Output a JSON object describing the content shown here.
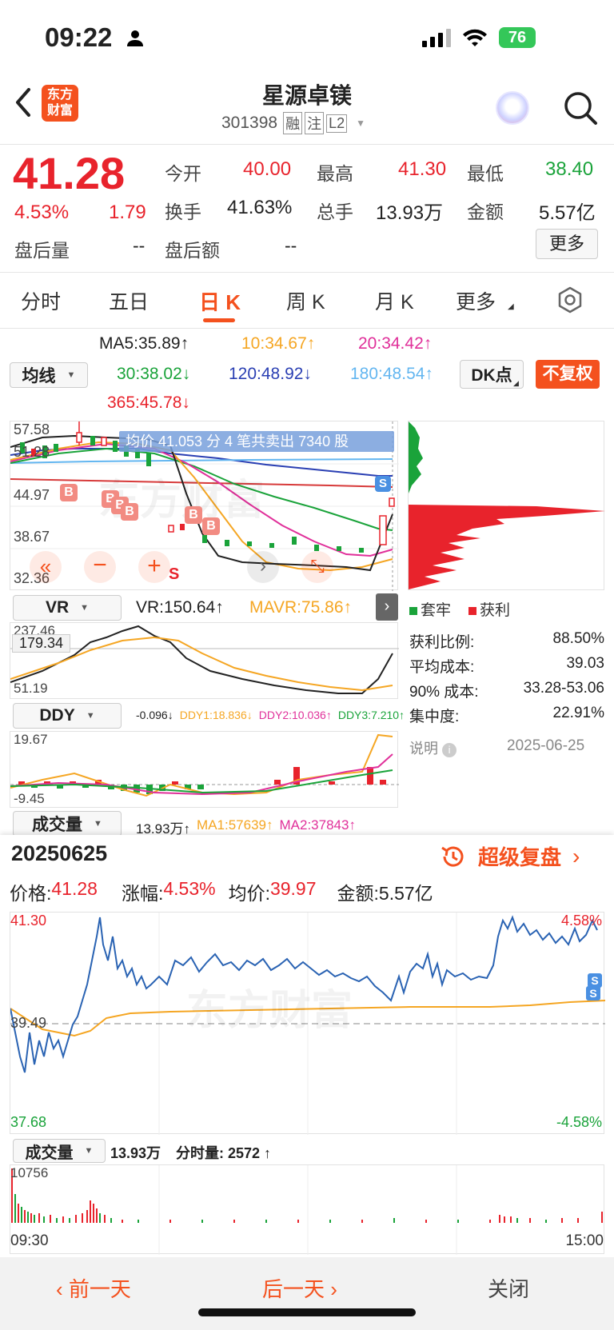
{
  "status": {
    "time": "09:22",
    "battery": "76"
  },
  "header": {
    "title": "星源卓镁",
    "code": "301398",
    "tags": [
      "融",
      "注",
      "L2"
    ],
    "logo_line1": "东方",
    "logo_line2": "财富"
  },
  "quote": {
    "price": "41.28",
    "pct": "4.53%",
    "chg": "1.79",
    "open_label": "今开",
    "open": "40.00",
    "high_label": "最高",
    "high": "41.30",
    "low_label": "最低",
    "low": "38.40",
    "turnover_label": "换手",
    "turnover": "41.63%",
    "volume_label": "总手",
    "volume": "13.93万",
    "amount_label": "金额",
    "amount": "5.57亿",
    "after_vol_label": "盘后量",
    "after_vol": "--",
    "after_amt_label": "盘后额",
    "after_amt": "--",
    "more_label": "更多"
  },
  "tabs": [
    {
      "label": "分时"
    },
    {
      "label": "五日"
    },
    {
      "label": "日 K"
    },
    {
      "label": "周 K"
    },
    {
      "label": "月 K"
    },
    {
      "label": "更多"
    }
  ],
  "ma": {
    "select": "均线",
    "ma5": "MA5:35.89↑",
    "ma10": "10:34.67↑",
    "ma20": "20:34.42↑",
    "ma30": "30:38.02↓",
    "ma120": "120:48.92↓",
    "ma180": "180:48.54↑",
    "ma365": "365:45.78↓",
    "dk": "DK点",
    "fq": "不复权"
  },
  "kchart": {
    "y_labels": [
      "57.58",
      "51.28",
      "44.97",
      "38.67",
      "32.36"
    ],
    "tooltip": "均价 41.053 分 4 笔共卖出 7340 股",
    "watermark": "东方财富",
    "b_marker": "B",
    "s_marker": "S"
  },
  "chips": {
    "legend_trapped": "套牢",
    "legend_profit": "获利",
    "rows": [
      {
        "label": "获利比例:",
        "value": "88.50%"
      },
      {
        "label": "平均成本:",
        "value": "39.03"
      },
      {
        "label": "90% 成本:",
        "value": "33.28-53.06"
      },
      {
        "label": "集中度:",
        "value": "22.91%"
      }
    ],
    "note_label": "说明",
    "note_date": "2025-06-25"
  },
  "vr": {
    "select": "VR",
    "value": "VR:150.64↑",
    "mavr": "MAVR:75.86↑",
    "y_top": "237.46",
    "y_bottom": "51.19",
    "crosshair": "179.34"
  },
  "ddy": {
    "select": "DDY",
    "v0": "-0.096↓",
    "v1": "DDY1:18.836↓",
    "v2": "DDY2:10.036↑",
    "v3": "DDY3:7.210↑",
    "y_top": "19.67",
    "y_bottom": "-9.45"
  },
  "vol": {
    "select": "成交量",
    "value": "13.93万↑",
    "ma1": "MA1:57639↑",
    "ma2": "MA2:37843↑"
  },
  "intraday": {
    "date": "20250625",
    "replay": "超级复盘",
    "price_label": "价格:",
    "price": "41.28",
    "pct_label": "涨幅:",
    "pct": "4.53%",
    "avg_label": "均价:",
    "avg": "39.97",
    "amt_label": "金额:",
    "amt": "5.57亿",
    "y_top": "41.30",
    "y_mid": "39.49",
    "y_bottom": "37.68",
    "pct_top": "4.58%",
    "pct_bottom": "-4.58%",
    "vol_select": "成交量",
    "vol_value": "13.93万",
    "vol_min": "分时量: 2572 ↑",
    "vol_max": "10756",
    "t_start": "09:30",
    "t_end": "15:00"
  },
  "footer": {
    "prev": "前一天",
    "next": "后一天",
    "close": "关闭"
  }
}
